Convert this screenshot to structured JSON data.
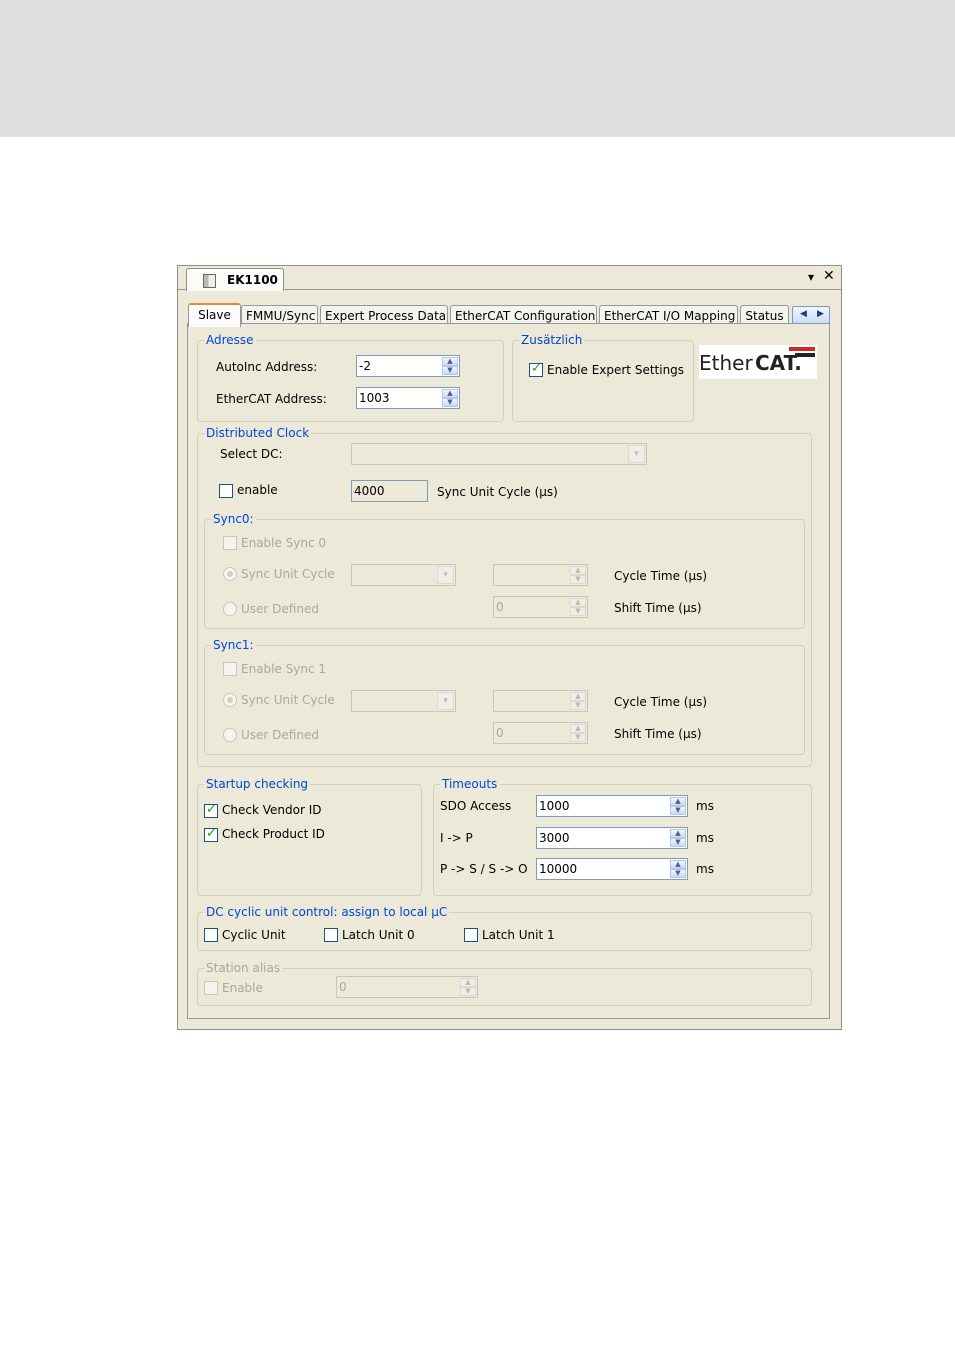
{
  "window": {
    "tab_title": "EK1100",
    "arrow_glyph": "▾",
    "close_glyph": "✕"
  },
  "tabs": [
    "Slave",
    "FMMU/Sync",
    "Expert Process Data",
    "EtherCAT Configuration",
    "EtherCAT I/O Mapping",
    "Status"
  ],
  "tab_scroll": {
    "left": "◀",
    "right": "▶"
  },
  "adresse": {
    "legend": "Adresse",
    "autoinc_label": "AutoInc Address:",
    "autoinc_value": "-2",
    "ethercat_label": "EtherCAT Address:",
    "ethercat_value": "1003"
  },
  "zusaetzlich": {
    "legend": "Zusätzlich",
    "expert_label": "Enable Expert Settings",
    "expert_checked": true
  },
  "logo": {
    "ether": "Ether",
    "cat": "CAT."
  },
  "dc": {
    "legend": "Distributed Clock",
    "select_label": "Select DC:",
    "enable_label": "enable",
    "cycle_value": "4000",
    "cycle_label": "Sync Unit Cycle (µs)"
  },
  "sync0": {
    "legend": "Sync0:",
    "enable_label": "Enable Sync 0",
    "sync_unit_label": "Sync Unit Cycle",
    "user_defined_label": "User Defined",
    "cycle_time_label": "Cycle Time (µs)",
    "shift_time_label": "Shift Time (µs)",
    "shift_value": "0"
  },
  "sync1": {
    "legend": "Sync1:",
    "enable_label": "Enable Sync 1",
    "sync_unit_label": "Sync Unit Cycle",
    "user_defined_label": "User Defined",
    "cycle_time_label": "Cycle Time (µs)",
    "shift_time_label": "Shift Time (µs)",
    "shift_value": "0"
  },
  "startup": {
    "legend": "Startup checking",
    "vendor_label": "Check Vendor ID",
    "product_label": "Check Product ID"
  },
  "timeouts": {
    "legend": "Timeouts",
    "sdo_label": "SDO Access",
    "sdo_value": "1000",
    "ip_label": "I -> P",
    "ip_value": "3000",
    "ps_label": "P -> S / S -> O",
    "ps_value": "10000",
    "unit": "ms"
  },
  "dc_cyclic": {
    "legend": "DC cyclic unit control: assign to local µC",
    "cyclic_label": "Cyclic Unit",
    "latch0_label": "Latch Unit 0",
    "latch1_label": "Latch Unit 1"
  },
  "station_alias": {
    "legend": "Station alias",
    "enable_label": "Enable",
    "value": "0"
  },
  "spin_glyphs": {
    "up": "▲",
    "down": "▼"
  },
  "combo_glyph": "▾",
  "check_glyph": "✓"
}
